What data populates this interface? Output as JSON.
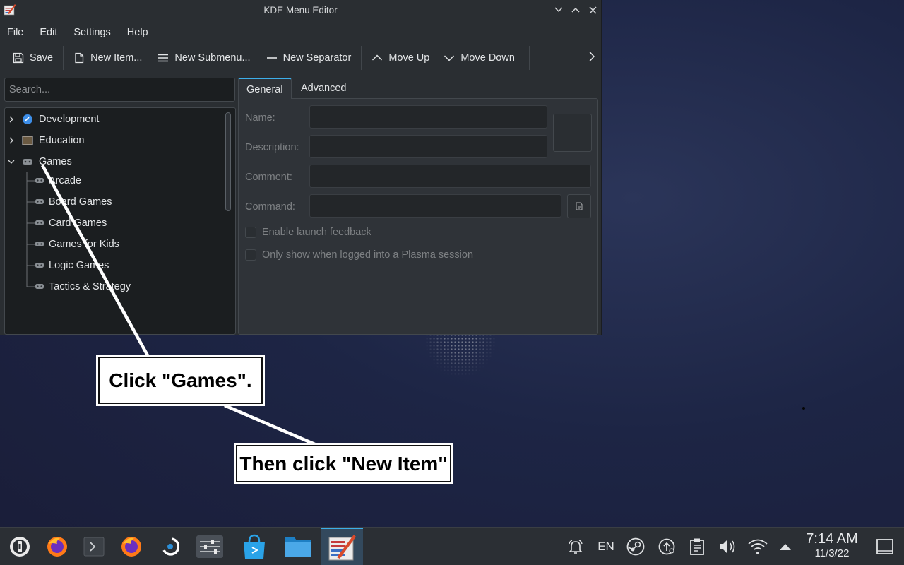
{
  "window": {
    "title": "KDE Menu Editor"
  },
  "menubar": [
    "File",
    "Edit",
    "Settings",
    "Help"
  ],
  "toolbar": {
    "save": "Save",
    "new_item": "New Item...",
    "new_submenu": "New Submenu...",
    "new_separator": "New Separator",
    "move_up": "Move Up",
    "move_down": "Move Down"
  },
  "search": {
    "placeholder": "Search..."
  },
  "tree": {
    "categories": [
      {
        "label": "Development",
        "icon": "development-icon",
        "expanded": false
      },
      {
        "label": "Education",
        "icon": "education-icon",
        "expanded": false
      },
      {
        "label": "Games",
        "icon": "gamepad-icon",
        "expanded": true
      }
    ],
    "games_children": [
      "Arcade",
      "Board Games",
      "Card Games",
      "Games for Kids",
      "Logic Games",
      "Tactics & Strategy"
    ]
  },
  "tabs": [
    "General",
    "Advanced"
  ],
  "form": {
    "name_label": "Name:",
    "description_label": "Description:",
    "comment_label": "Comment:",
    "command_label": "Command:",
    "launch_feedback": "Enable launch feedback",
    "plasma_only": "Only show when logged into a Plasma session"
  },
  "annotations": {
    "step1": "Click \"Games\".",
    "step2": "Then click \"New Item\""
  },
  "taskbar": {
    "language": "EN",
    "time": "7:14 AM",
    "date": "11/3/22"
  },
  "colors": {
    "accent": "#3daee9",
    "window_bg": "#2a2e32",
    "input_bg": "#1b1e20"
  }
}
